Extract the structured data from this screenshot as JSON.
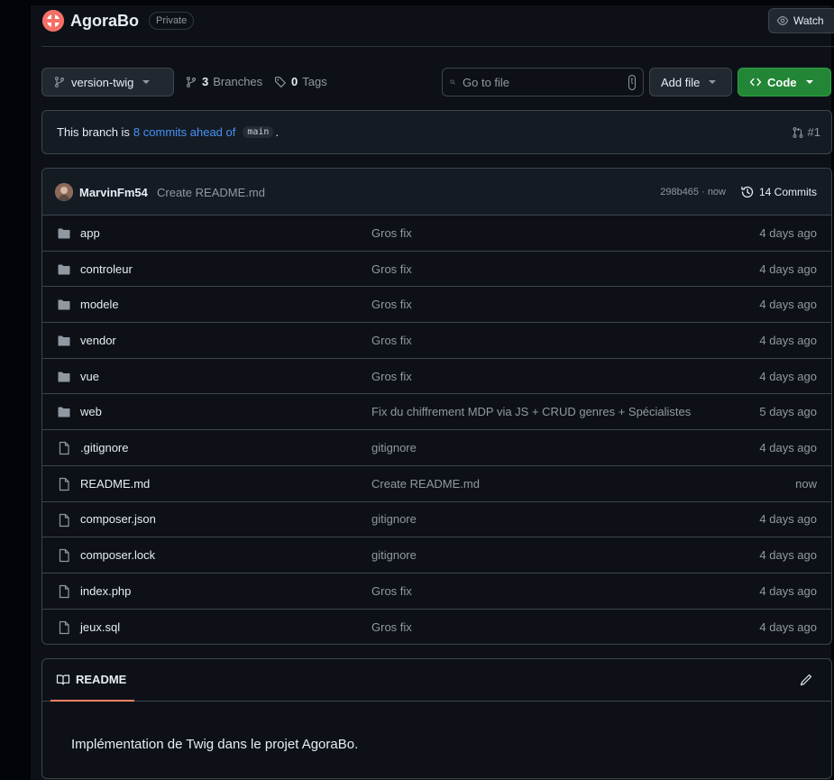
{
  "repo": {
    "name": "AgoraBo",
    "visibility": "Private",
    "watch_label": "Watch"
  },
  "toolbar": {
    "branch": "version-twig",
    "branches_count": "3",
    "branches_label": "Branches",
    "tags_count": "0",
    "tags_label": "Tags",
    "goto_placeholder": "Go to file",
    "goto_kbd": "t",
    "add_file_label": "Add file",
    "code_label": "Code"
  },
  "branch_status": {
    "prefix": "This branch is",
    "ahead_link": "8 commits ahead of",
    "base_branch": "main",
    "suffix": ".",
    "pr_label": "#1"
  },
  "latest_commit": {
    "author": "MarvinFm54",
    "message": "Create README.md",
    "meta": "298b465 · now",
    "commits_label": "14 Commits"
  },
  "files": [
    {
      "type": "dir",
      "name": "app",
      "message": "Gros fix",
      "date": "4 days ago"
    },
    {
      "type": "dir",
      "name": "controleur",
      "message": "Gros fix",
      "date": "4 days ago"
    },
    {
      "type": "dir",
      "name": "modele",
      "message": "Gros fix",
      "date": "4 days ago"
    },
    {
      "type": "dir",
      "name": "vendor",
      "message": "Gros fix",
      "date": "4 days ago"
    },
    {
      "type": "dir",
      "name": "vue",
      "message": "Gros fix",
      "date": "4 days ago"
    },
    {
      "type": "dir",
      "name": "web",
      "message": "Fix du chiffrement MDP via JS + CRUD genres + Spécialistes",
      "date": "5 days ago"
    },
    {
      "type": "file",
      "name": ".gitignore",
      "message": "gitignore",
      "date": "4 days ago"
    },
    {
      "type": "file",
      "name": "README.md",
      "message": "Create README.md",
      "date": "now"
    },
    {
      "type": "file",
      "name": "composer.json",
      "message": "gitignore",
      "date": "4 days ago"
    },
    {
      "type": "file",
      "name": "composer.lock",
      "message": "gitignore",
      "date": "4 days ago"
    },
    {
      "type": "file",
      "name": "index.php",
      "message": "Gros fix",
      "date": "4 days ago"
    },
    {
      "type": "file",
      "name": "jeux.sql",
      "message": "Gros fix",
      "date": "4 days ago"
    }
  ],
  "readme": {
    "tab_label": "README",
    "content": "Implémentation de Twig dans le projet AgoraBo."
  },
  "colors": {
    "background": "#0d1117",
    "border": "#3d444d",
    "link": "#4493f8",
    "code_button": "#238636",
    "readme_underline": "#f78166"
  }
}
